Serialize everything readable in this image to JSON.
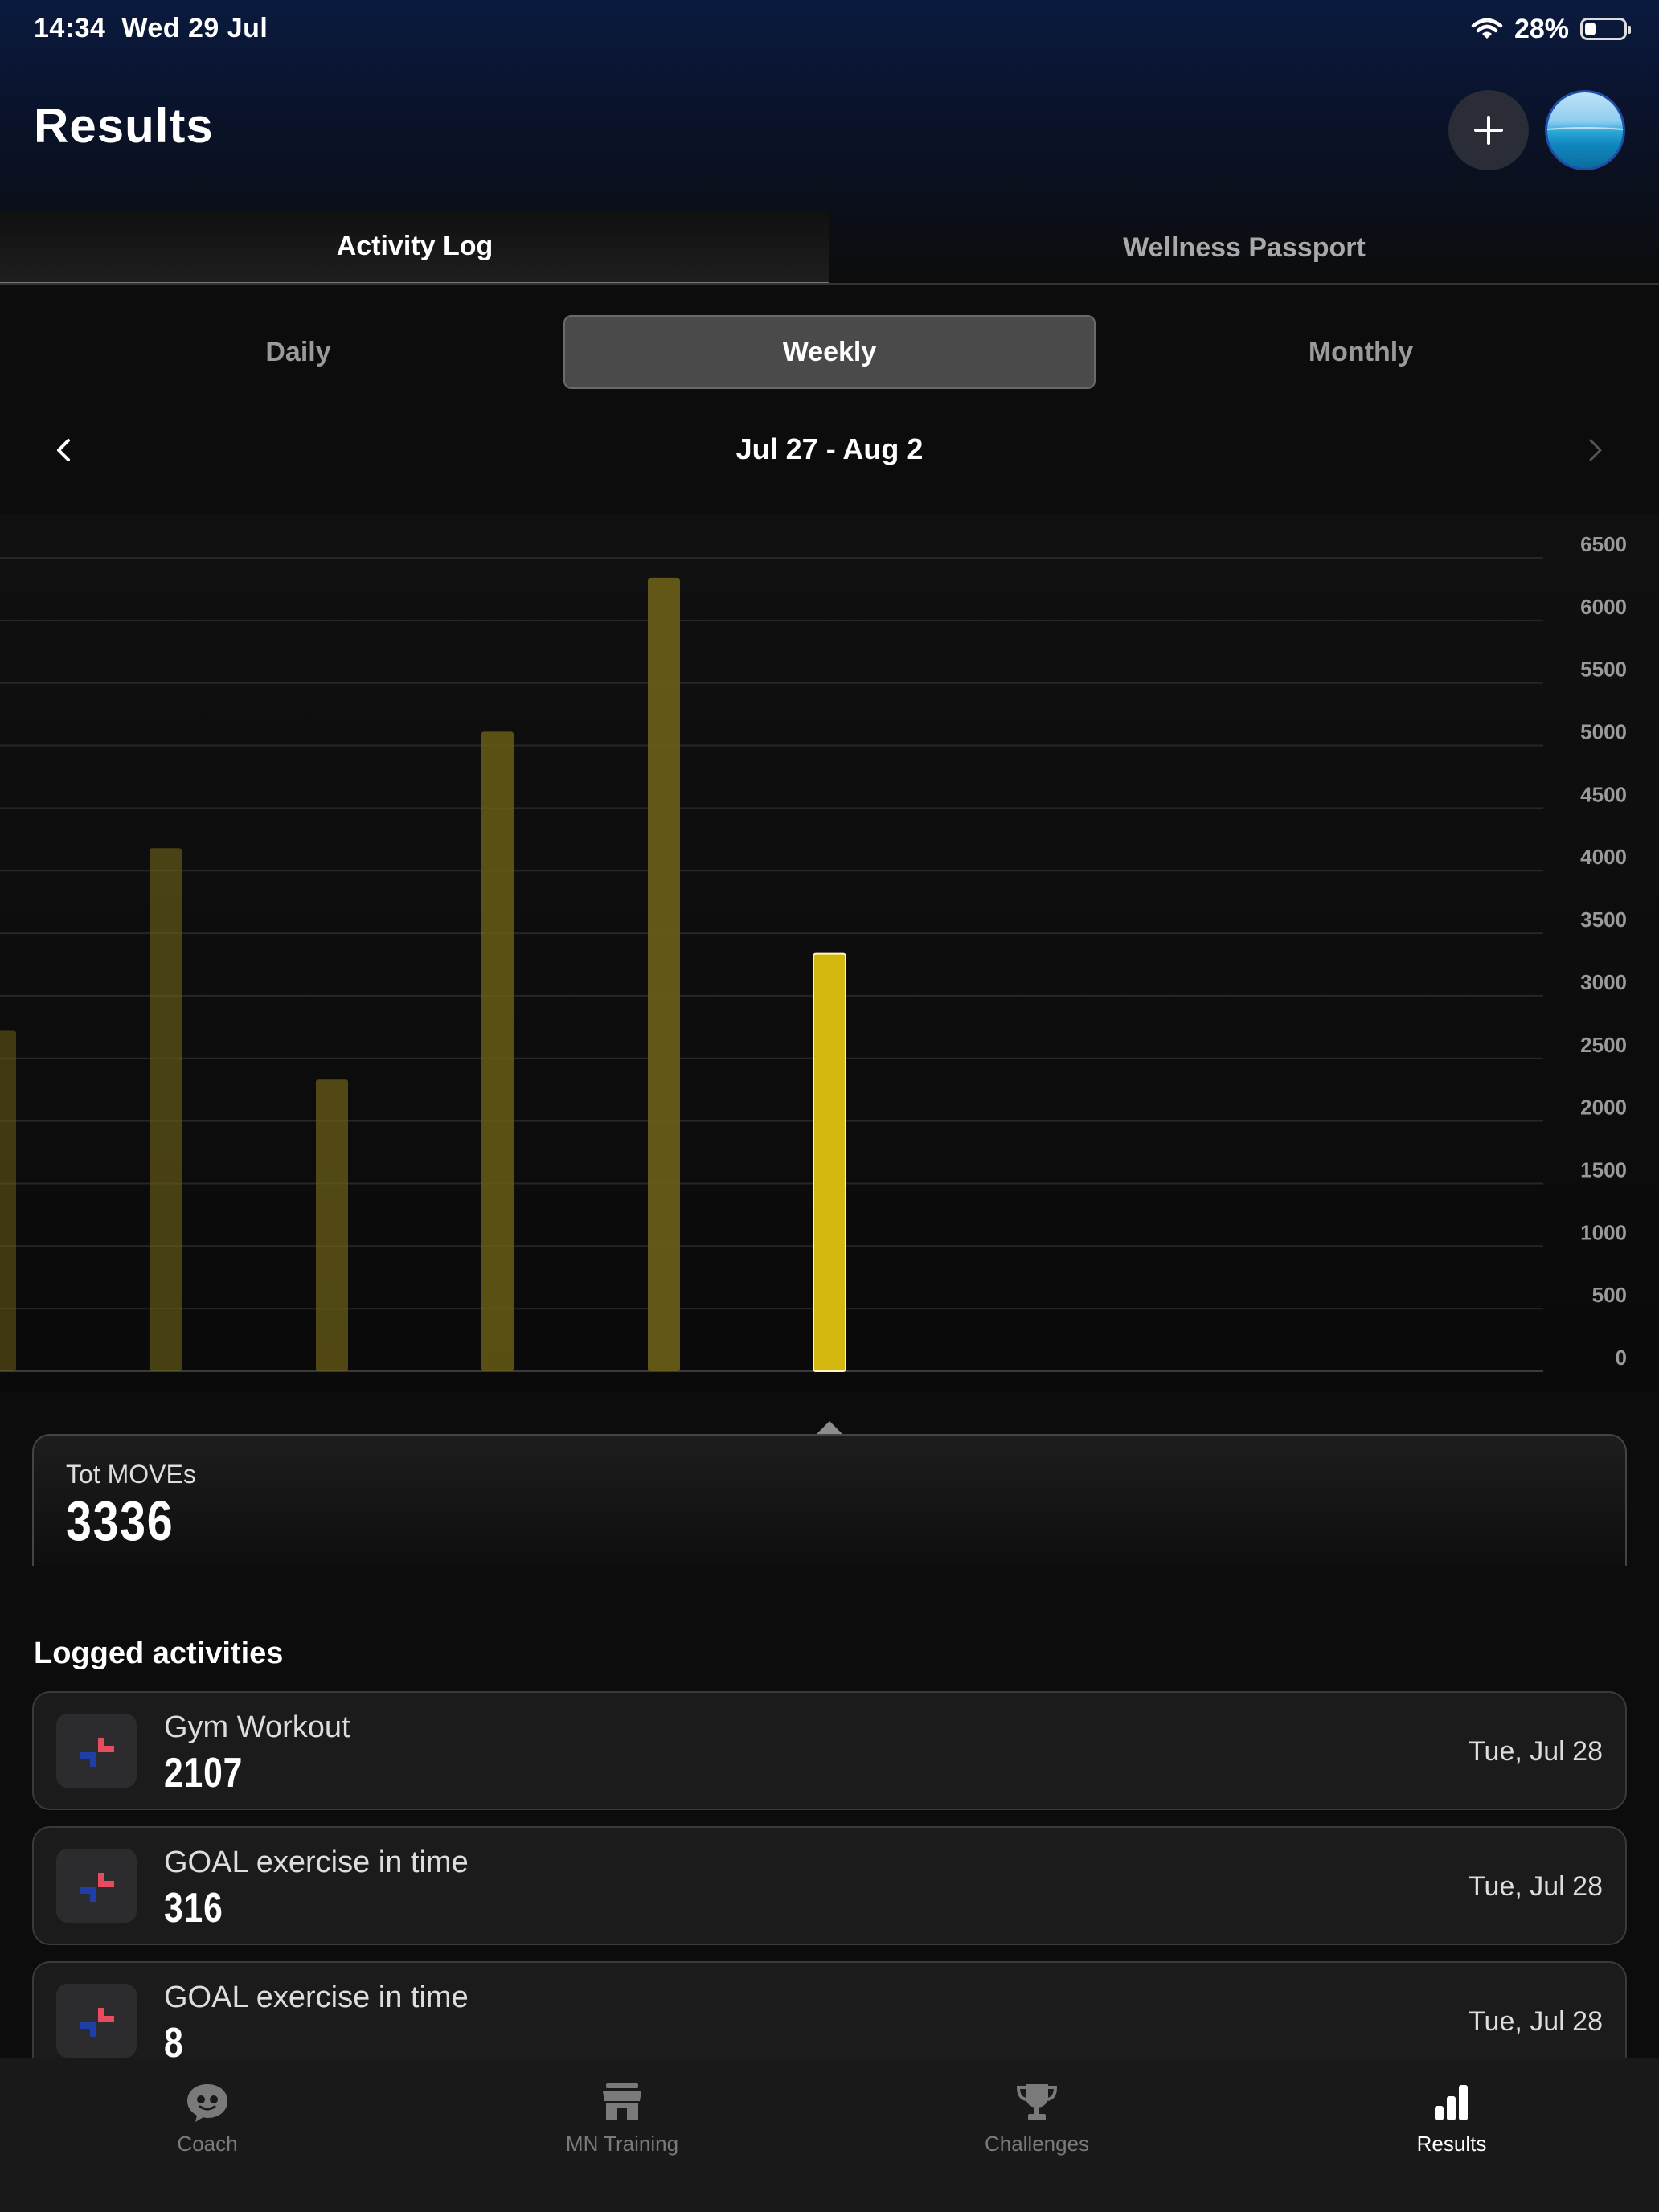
{
  "status_bar": {
    "time": "14:34",
    "date": "Wed 29 Jul",
    "battery_pct": "28%",
    "battery_level": 0.28
  },
  "header": {
    "title": "Results"
  },
  "top_tabs": [
    {
      "label": "Activity Log",
      "active": true
    },
    {
      "label": "Wellness Passport",
      "active": false
    }
  ],
  "period_tabs": [
    {
      "label": "Daily",
      "active": false
    },
    {
      "label": "Weekly",
      "active": true
    },
    {
      "label": "Monthly",
      "active": false
    }
  ],
  "date_range": "Jul 27 - Aug 2",
  "chart_data": {
    "type": "bar",
    "title": "",
    "xlabel": "",
    "ylabel": "",
    "ylim": [
      0,
      6500
    ],
    "yticks": [
      0,
      500,
      1000,
      1500,
      2000,
      2500,
      3000,
      3500,
      4000,
      4500,
      5000,
      5500,
      6000,
      6500
    ],
    "grid": true,
    "values": [
      2720,
      4180,
      2330,
      5110,
      6340,
      3336
    ],
    "selected_index": 5,
    "colors": {
      "bar": "#6b5f17",
      "selected": "#d4b80f"
    }
  },
  "summary": {
    "label": "Tot MOVEs",
    "value": "3336"
  },
  "logged": {
    "title": "Logged activities",
    "items": [
      {
        "name": "Gym Workout",
        "value": "2107",
        "date": "Tue, Jul 28"
      },
      {
        "name": "GOAL exercise in time",
        "value": "316",
        "date": "Tue, Jul 28"
      },
      {
        "name": "GOAL exercise in time",
        "value": "8",
        "date": "Tue, Jul 28"
      }
    ]
  },
  "bottom_nav": [
    {
      "label": "Coach",
      "icon": "coach-icon",
      "active": false
    },
    {
      "label": "MN Training",
      "icon": "store-icon",
      "active": false
    },
    {
      "label": "Challenges",
      "icon": "trophy-icon",
      "active": false
    },
    {
      "label": "Results",
      "icon": "bar-chart-icon",
      "active": true
    }
  ]
}
